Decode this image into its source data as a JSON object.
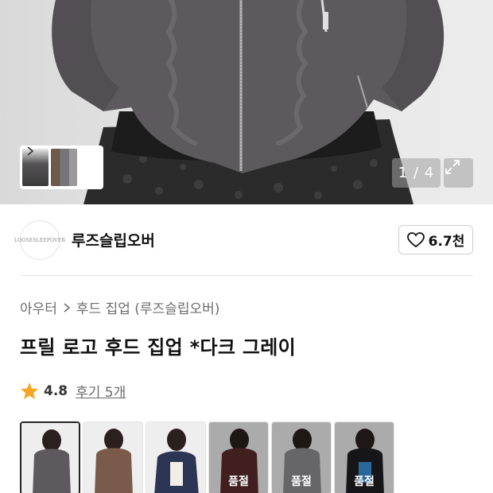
{
  "gallery": {
    "counter": "1 / 4"
  },
  "brand": {
    "logo_text": "LOOSESLEEPOVER",
    "name": "루즈슬립오버",
    "likes": "6.7천"
  },
  "breadcrumb": {
    "category": "아우터",
    "subcategory": "후드 집업 (루즈슬립오버)"
  },
  "product": {
    "title": "프릴 로고 후드 집업 *다크 그레이",
    "rating": "4.8",
    "reviews": "후기 5개"
  },
  "options": [
    {
      "color": "#5c5a5c",
      "soldout_label": ""
    },
    {
      "color": "#7a5a4b",
      "soldout_label": ""
    },
    {
      "color": "#2c3554",
      "soldout_label": ""
    },
    {
      "color": "#5a2a2c",
      "soldout_label": "품절"
    },
    {
      "color": "#8e8e90",
      "soldout_label": "품절"
    },
    {
      "color": "#1f1f22",
      "soldout_label": "품절"
    }
  ],
  "colors": {
    "star": "#f5a623",
    "hoodie": "#5c5a5c"
  }
}
